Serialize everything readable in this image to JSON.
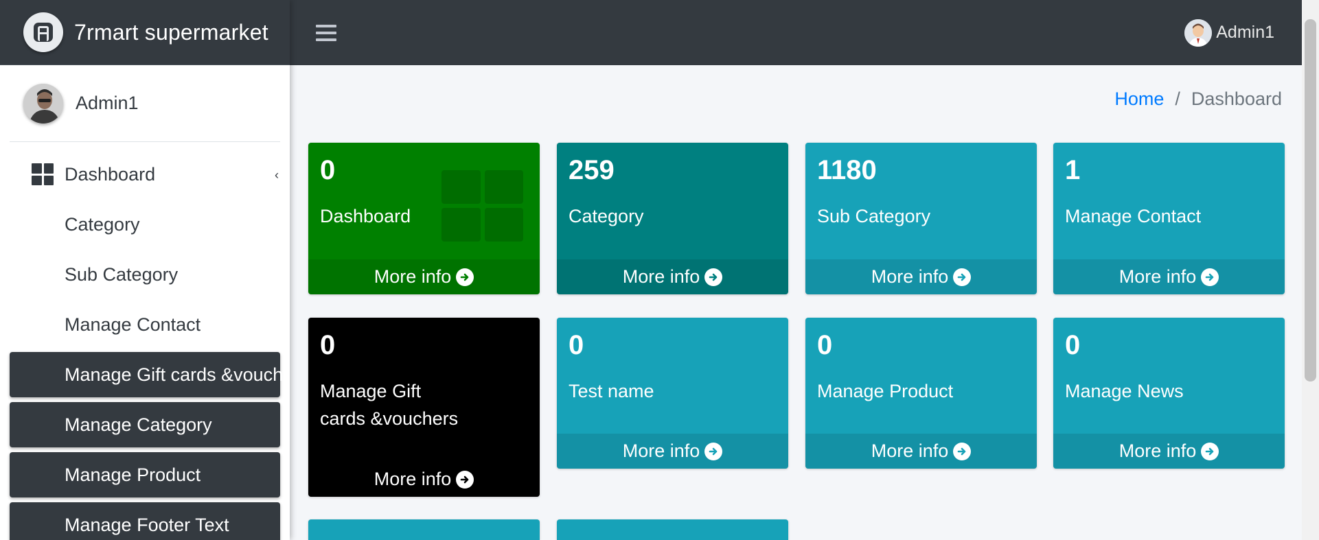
{
  "app": {
    "brand_name": "7rmart supermarket",
    "brand_logo_icon": "admin-logo-icon"
  },
  "topbar": {
    "menu_icon": "hamburger-icon",
    "user_name": "Admin1"
  },
  "sidebar": {
    "user_name": "Admin1",
    "items": [
      {
        "label": "Dashboard",
        "style": "top",
        "icon": "dashboard-grid-icon"
      },
      {
        "label": "Category",
        "style": "plain"
      },
      {
        "label": "Sub Category",
        "style": "plain"
      },
      {
        "label": "Manage Contact",
        "style": "plain"
      },
      {
        "label": "Manage Gift cards &voucher",
        "style": "dark"
      },
      {
        "label": "Manage Category",
        "style": "dark"
      },
      {
        "label": "Manage Product",
        "style": "dark"
      },
      {
        "label": "Manage Footer Text",
        "style": "dark"
      }
    ]
  },
  "breadcrumb": {
    "home": "Home",
    "separator": "/",
    "current": "Dashboard"
  },
  "cards": [
    {
      "count": "0",
      "label": "Dashboard",
      "footer": "More info",
      "color": "#008000"
    },
    {
      "count": "259",
      "label": "Category",
      "footer": "More info",
      "color": "#008080"
    },
    {
      "count": "1180",
      "label": "Sub Category",
      "footer": "More info",
      "color": "#17a2b8"
    },
    {
      "count": "1",
      "label": "Manage Contact",
      "footer": "More info",
      "color": "#17a2b8"
    },
    {
      "count": "0",
      "label": "Manage Gift cards &vouchers",
      "footer": "More info",
      "color": "#000000"
    },
    {
      "count": "0",
      "label": "Test name",
      "footer": "More info",
      "color": "#17a2b8"
    },
    {
      "count": "0",
      "label": "Manage Product",
      "footer": "More info",
      "color": "#17a2b8"
    },
    {
      "count": "0",
      "label": "Manage News",
      "footer": "More info",
      "color": "#17a2b8"
    }
  ],
  "colors": {
    "topbar": "#343a40",
    "link": "#007bff",
    "info": "#17a2b8",
    "teal": "#008080",
    "green": "#008000"
  }
}
